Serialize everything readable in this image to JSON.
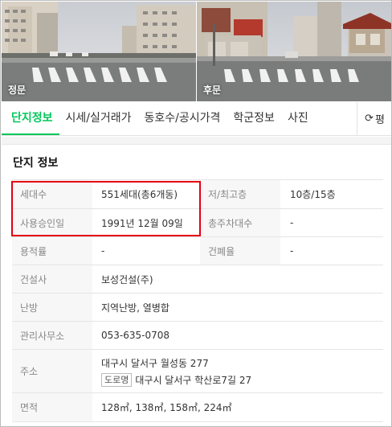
{
  "photos": [
    {
      "label": "정문"
    },
    {
      "label": "후문"
    }
  ],
  "tabs": [
    {
      "label": "단지정보",
      "active": true
    },
    {
      "label": "시세/실거래가"
    },
    {
      "label": "동호수/공시가격"
    },
    {
      "label": "학군정보"
    },
    {
      "label": "사진"
    }
  ],
  "refresh": {
    "label": "평",
    "icon": "refresh-icon"
  },
  "section": {
    "title": "단지 정보"
  },
  "rows": {
    "households": {
      "label": "세대수",
      "value": "551세대(총6개동)",
      "label2": "저/최고층",
      "value2": "10층/15층"
    },
    "approval": {
      "label": "사용승인일",
      "value": "1991년 12월 09일",
      "label2": "총주차대수",
      "value2": "-"
    },
    "ratio": {
      "label": "용적률",
      "value": "-",
      "label2": "건폐율",
      "value2": "-"
    },
    "builder": {
      "label": "건설사",
      "value": "보성건설(주)"
    },
    "heating": {
      "label": "난방",
      "value": "지역난방, 열병합"
    },
    "office": {
      "label": "관리사무소",
      "value": "053-635-0708"
    },
    "address": {
      "label": "주소",
      "lot": "대구시 달서구 월성동 277",
      "road_badge": "도로명",
      "road": "대구시 달서구 학산로7길 27"
    },
    "area": {
      "label": "면적",
      "value": "128㎡, 138㎡, 158㎡, 224㎡"
    }
  },
  "colors": {
    "accent": "#03c75a",
    "highlight": "#e60012"
  }
}
